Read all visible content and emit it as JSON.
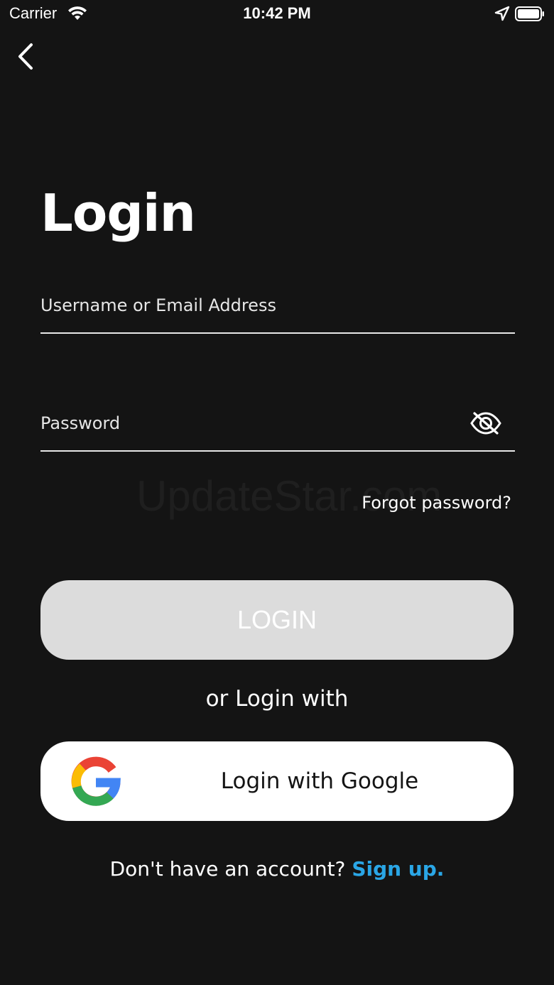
{
  "status_bar": {
    "carrier": "Carrier",
    "time": "10:42 PM",
    "icons": [
      "wifi-icon",
      "location-arrow-icon",
      "battery-icon"
    ]
  },
  "nav": {
    "back_icon": "chevron-left-icon"
  },
  "title": "Login",
  "form": {
    "username": {
      "placeholder": "Username or Email Address",
      "value": ""
    },
    "password": {
      "placeholder": "Password",
      "value": "",
      "toggle_icon": "eye-slash-icon"
    },
    "forgot_label": "Forgot password?"
  },
  "watermark": "UpdateStar.com",
  "login_button": {
    "label": "LOGIN"
  },
  "alt_login_label": "or Login with",
  "google_button": {
    "label": "Login with Google",
    "icon": "google-logo-icon"
  },
  "signup": {
    "prompt": "Don't have an account? ",
    "link": "Sign up."
  },
  "colors": {
    "background": "#141414",
    "login_button_bg": "#dcdcdc",
    "link": "#2aa6e6"
  }
}
